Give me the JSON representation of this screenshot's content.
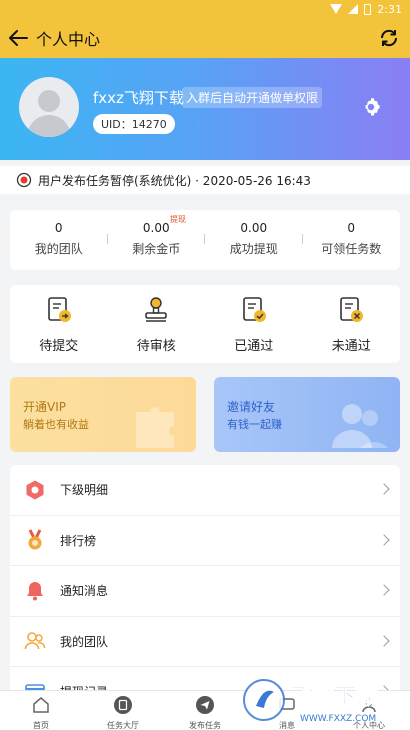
{
  "status_bar": {
    "time": "2:31"
  },
  "header": {
    "title": "个人中心"
  },
  "profile": {
    "nickname": "fxxz飞翔下载",
    "tag": "入群后自动开通做单权限",
    "uid": "UID：14270"
  },
  "notice": {
    "text": "用户发布任务暂停(系统优化) · 2020-05-26 16:43"
  },
  "stats": [
    {
      "value": "0",
      "label": "我的团队"
    },
    {
      "value": "0.00",
      "label": "剩余金币"
    },
    {
      "value": "0.00",
      "label": "成功提现"
    },
    {
      "value": "0",
      "label": "可领任务数"
    }
  ],
  "withdraw_tag": "提现",
  "tasks": [
    {
      "label": "待提交"
    },
    {
      "label": "待审核"
    },
    {
      "label": "已通过"
    },
    {
      "label": "未通过"
    }
  ],
  "promos": {
    "vip": {
      "title": "开通VIP",
      "subtitle": "躺着也有收益"
    },
    "invite": {
      "title": "邀请好友",
      "subtitle": "有钱一起赚"
    }
  },
  "menu": [
    {
      "label": "下级明细"
    },
    {
      "label": "排行榜"
    },
    {
      "label": "通知消息"
    },
    {
      "label": "我的团队"
    },
    {
      "label": "提现记录"
    }
  ],
  "bottom_nav": [
    {
      "label": "首页"
    },
    {
      "label": "任务大厅"
    },
    {
      "label": "发布任务"
    },
    {
      "label": "消息"
    },
    {
      "label": "个人中心"
    }
  ],
  "watermark": {
    "brand": "飞翔下载",
    "url": "WWW.FXXZ.COM"
  },
  "colors": {
    "header": "#f3c33b",
    "banner_start": "#3bb6f3",
    "banner_end": "#8a7ef4",
    "accent_red": "#e0532d"
  }
}
